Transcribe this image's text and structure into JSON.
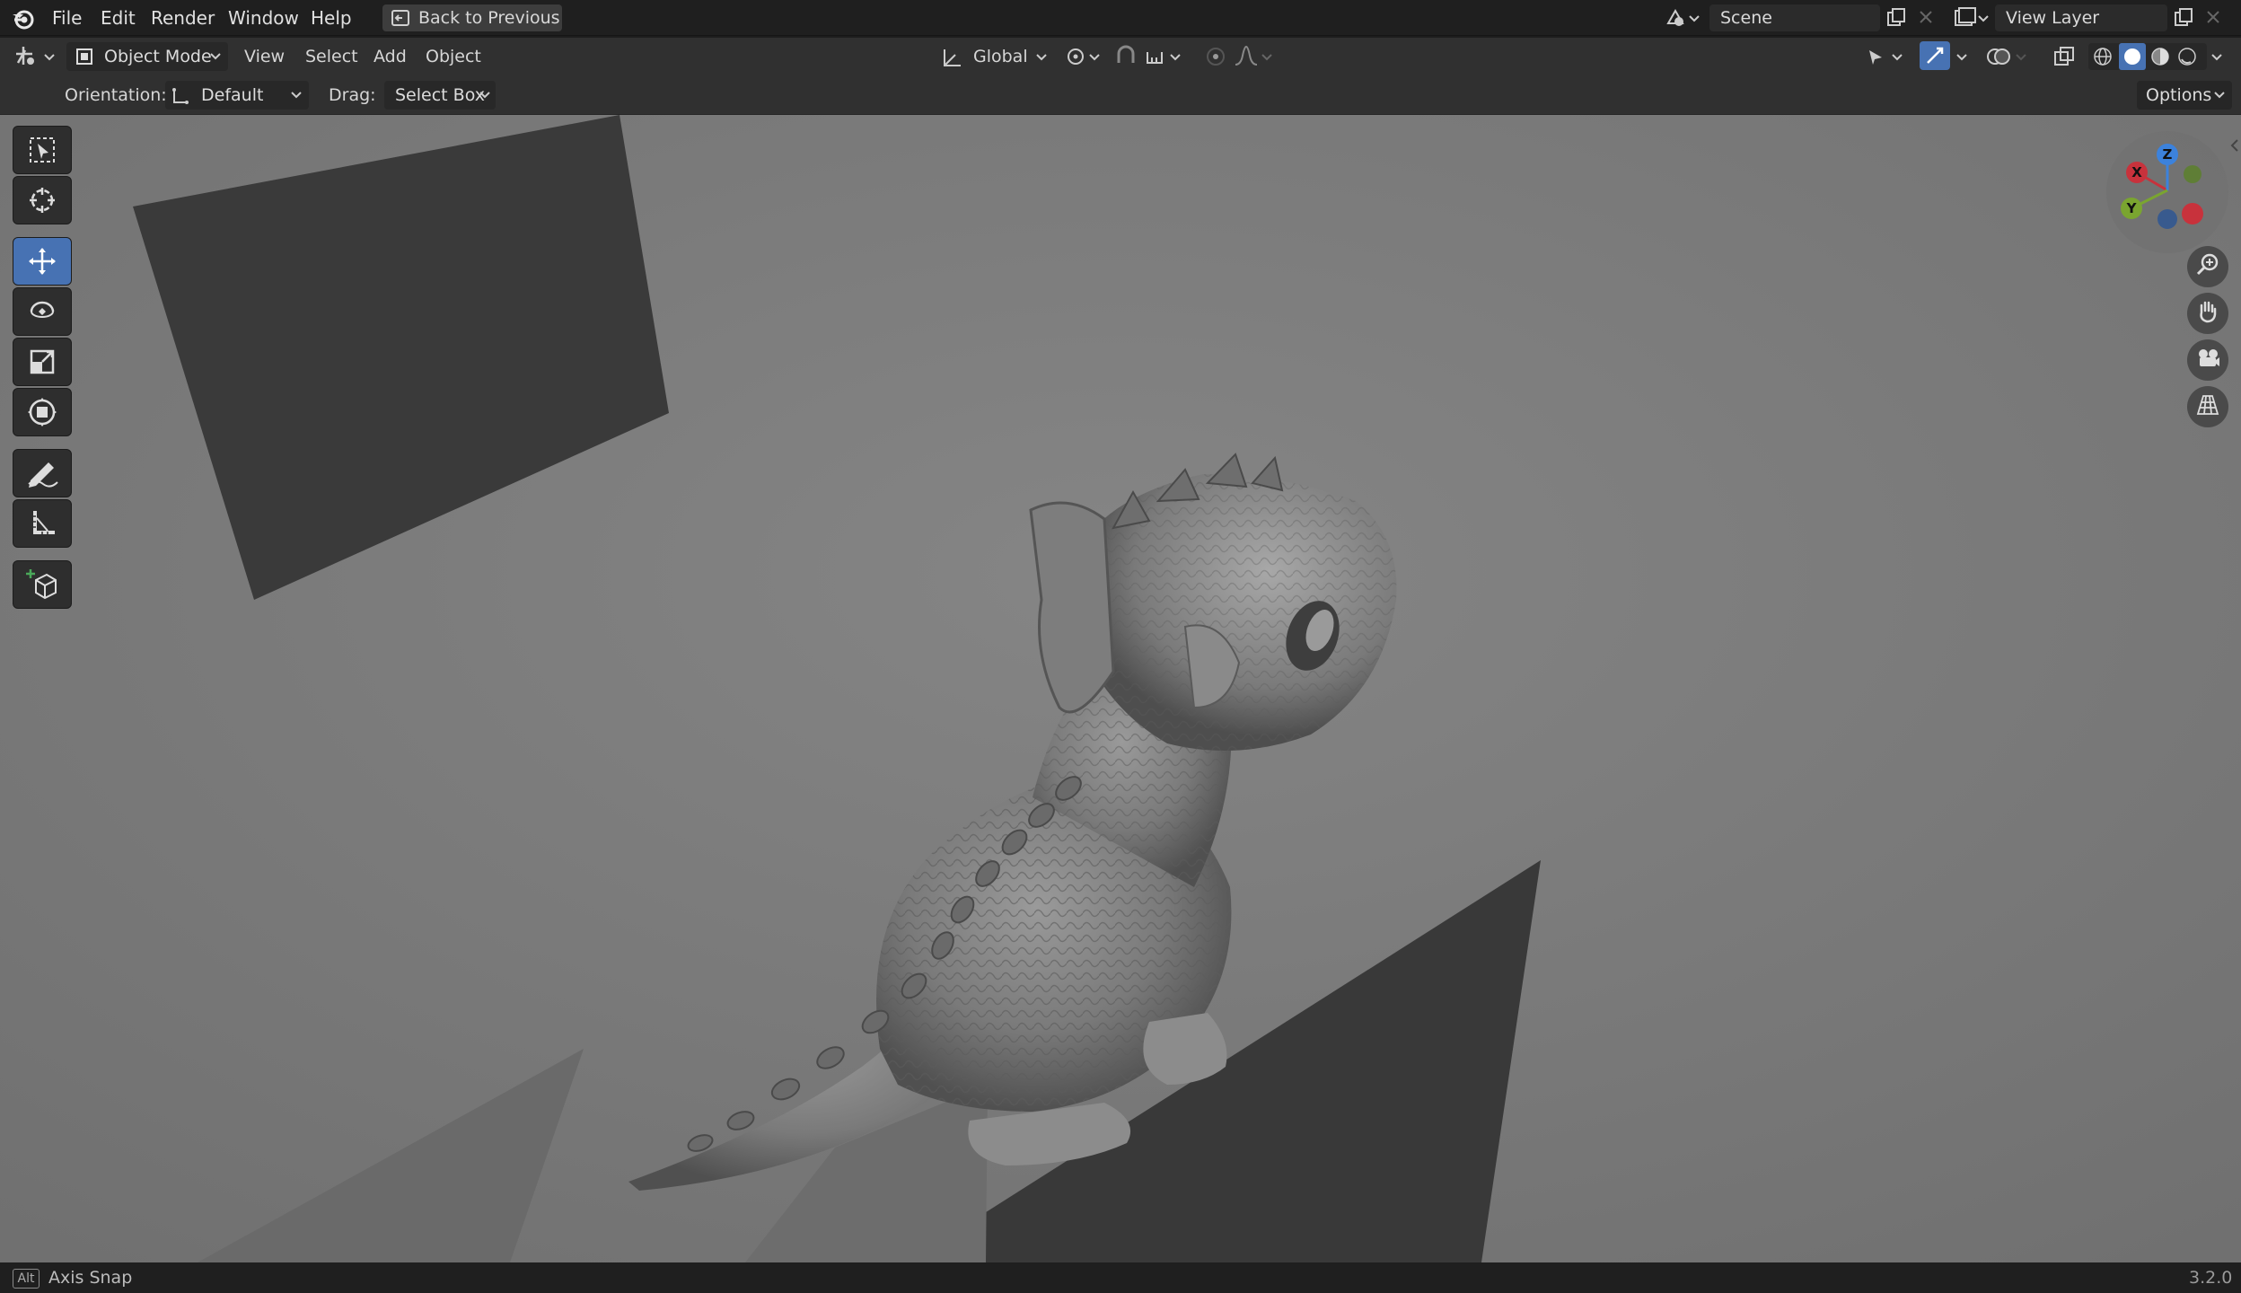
{
  "topbar": {
    "menus": [
      "File",
      "Edit",
      "Render",
      "Window",
      "Help"
    ],
    "back_button": "Back to Previous",
    "scene_label": "Scene",
    "view_layer_label": "View Layer"
  },
  "header": {
    "mode": "Object Mode",
    "menus": [
      "View",
      "Select",
      "Add",
      "Object"
    ],
    "transform_orientation": "Global"
  },
  "tool_settings": {
    "orientation_label": "Orientation:",
    "orientation_value": "Default",
    "drag_label": "Drag:",
    "drag_value": "Select Box",
    "options_label": "Options"
  },
  "toolbar": {
    "tools": [
      "select-box",
      "cursor",
      "move",
      "rotate",
      "scale",
      "transform",
      "annotate",
      "measure",
      "add-cube"
    ],
    "active_tool": "move"
  },
  "gizmo": {
    "x_label": "X",
    "y_label": "Y",
    "z_label": "Z",
    "colors": {
      "x": "#c8323c",
      "y": "#7aa530",
      "z": "#3c82dc"
    }
  },
  "statusbar": {
    "key_hint": "Alt",
    "hint_text": "Axis Snap",
    "version": "3.2.0"
  },
  "colors": {
    "accent": "#4772b3",
    "viewport_bg": "#7a7a7a"
  }
}
